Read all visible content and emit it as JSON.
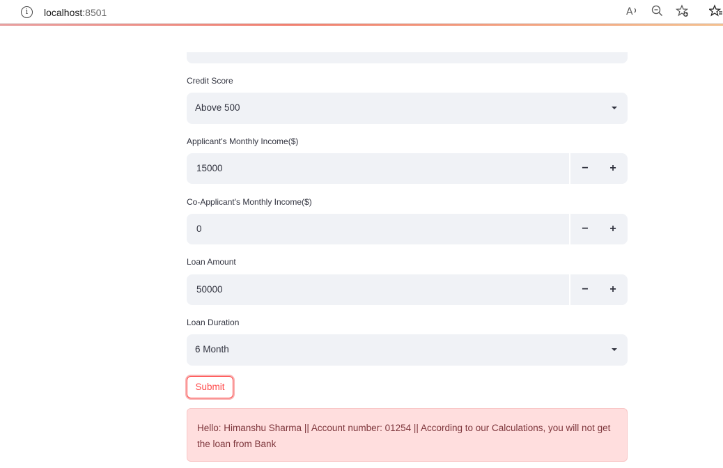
{
  "browser": {
    "url_host": "localhost",
    "url_port": ":8501",
    "icons": [
      "info-icon",
      "read-aloud-icon",
      "zoom-out-icon",
      "add-favorite-icon",
      "favorites-icon"
    ]
  },
  "form": {
    "credit_score": {
      "label": "Credit Score",
      "value": "Above 500"
    },
    "applicant_income": {
      "label": "Applicant's Monthly Income($)",
      "value": "15000"
    },
    "coapplicant_income": {
      "label": "Co-Applicant's Monthly Income($)",
      "value": "0"
    },
    "loan_amount": {
      "label": "Loan Amount",
      "value": "50000"
    },
    "loan_duration": {
      "label": "Loan Duration",
      "value": "6 Month"
    },
    "stepper": {
      "minus": "−",
      "plus": "+"
    },
    "submit_label": "Submit"
  },
  "alert": {
    "message": "Hello: Himanshu Sharma || Account number: 01254 || According to our Calculations, you will not get the loan from Bank"
  },
  "colors": {
    "accent": "#ff4b4b",
    "input_bg": "#f0f2f6",
    "alert_bg": "#ffdede",
    "alert_text": "#7d353b"
  }
}
